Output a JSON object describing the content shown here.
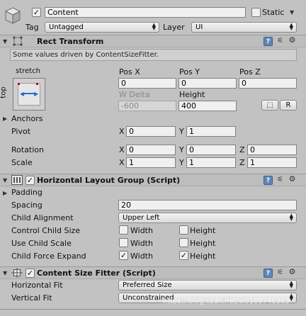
{
  "gameobject": {
    "name": "Content",
    "static_label": "Static",
    "tag_label": "Tag",
    "tag_value": "Untagged",
    "layer_label": "Layer",
    "layer_value": "UI"
  },
  "rect_transform": {
    "title": "Rect Transform",
    "info": "Some values driven by ContentSizeFitter.",
    "anchor_preset_top": "stretch",
    "anchor_preset_side": "top",
    "col_pos_x": "Pos X",
    "col_pos_y": "Pos Y",
    "col_pos_z": "Pos Z",
    "pos_x": "0",
    "pos_y": "0",
    "pos_z": "0",
    "col_w_delta": "W Delta",
    "col_height": "Height",
    "w_delta": "-600",
    "height": "400",
    "r_button": "R",
    "anchors_label": "Anchors",
    "pivot_label": "Pivot",
    "pivot_x": "0",
    "pivot_y": "1",
    "rotation_label": "Rotation",
    "rot_x": "0",
    "rot_y": "0",
    "rot_z": "0",
    "scale_label": "Scale",
    "scale_x": "1",
    "scale_y": "1",
    "scale_z": "1",
    "axis_x": "X",
    "axis_y": "Y",
    "axis_z": "Z"
  },
  "horizontal_layout_group": {
    "title": "Horizontal Layout Group (Script)",
    "padding_label": "Padding",
    "spacing_label": "Spacing",
    "spacing_value": "20",
    "child_alignment_label": "Child Alignment",
    "child_alignment_value": "Upper Left",
    "control_child_size_label": "Control Child Size",
    "use_child_scale_label": "Use Child Scale",
    "child_force_expand_label": "Child Force Expand",
    "width_label": "Width",
    "height_label": "Height",
    "control_child_size": {
      "width": false,
      "height": false
    },
    "use_child_scale": {
      "width": false,
      "height": false
    },
    "child_force_expand": {
      "width": true,
      "height": true
    }
  },
  "content_size_fitter": {
    "title": "Content Size Fitter (Script)",
    "horizontal_fit_label": "Horizontal Fit",
    "horizontal_fit_value": "Preferred Size",
    "vertical_fit_label": "Vertical Fit",
    "vertical_fit_value": "Unconstrained"
  },
  "watermark": "https://blog.csdn.net/w0100746363",
  "icons": {
    "gameobject": "cube-icon",
    "rect_transform": "rect-transform-icon",
    "layout_group": "layout-group-icon",
    "size_fitter": "size-fitter-icon",
    "help": "help-icon",
    "presets": "sliders-icon",
    "settings": "gear-icon",
    "blueprint": "blueprint-icon"
  }
}
